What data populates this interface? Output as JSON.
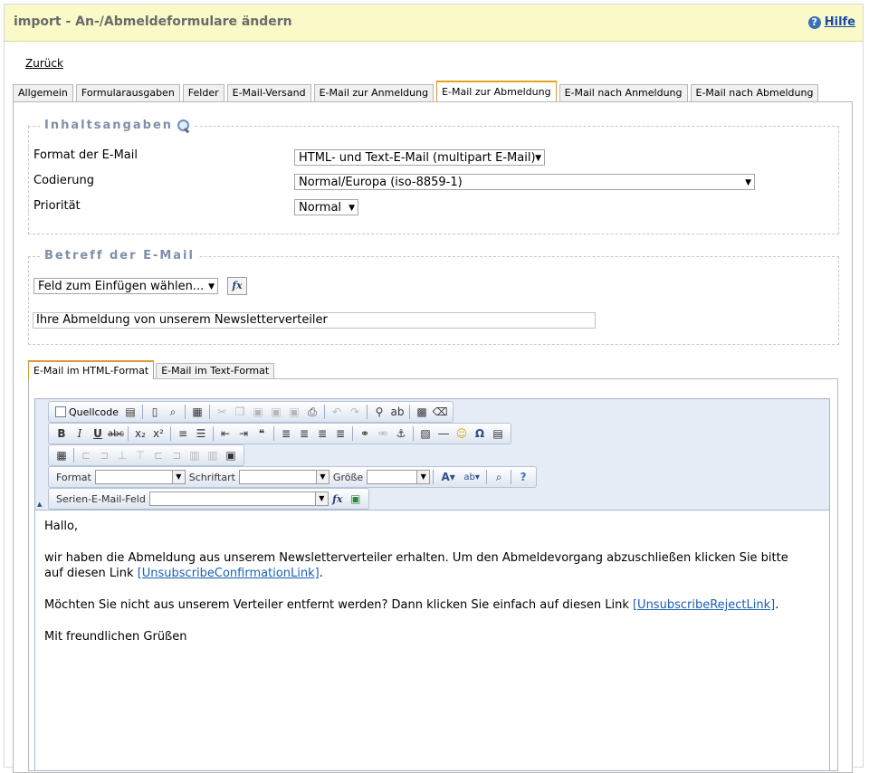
{
  "header": {
    "title": "import - An-/Abmeldeformulare ändern",
    "help_label": "Hilfe",
    "help_icon": "question-icon"
  },
  "back_link": "Zurück",
  "tabs": [
    {
      "label": "Allgemein",
      "active": false
    },
    {
      "label": "Formularausgaben",
      "active": false
    },
    {
      "label": "Felder",
      "active": false
    },
    {
      "label": "E-Mail-Versand",
      "active": false
    },
    {
      "label": "E-Mail zur Anmeldung",
      "active": false
    },
    {
      "label": "E-Mail zur Abmeldung",
      "active": true
    },
    {
      "label": "E-Mail nach Anmeldung",
      "active": false
    },
    {
      "label": "E-Mail nach Abmeldung",
      "active": false
    }
  ],
  "content_section": {
    "legend": "Inhaltsangaben",
    "format_label": "Format der E-Mail",
    "format_value": "HTML- und Text-E-Mail (multipart E-Mail)",
    "encoding_label": "Codierung",
    "encoding_value": "Normal/Europa (iso-8859-1)",
    "priority_label": "Priorität",
    "priority_value": "Normal"
  },
  "subject_section": {
    "legend": "Betreff der E-Mail",
    "field_select": "Feld zum Einfügen wählen...",
    "fx_label": "fx",
    "subject_value": "Ihre Abmeldung von unserem Newsletterverteiler"
  },
  "subtabs": [
    {
      "label": "E-Mail im HTML-Format",
      "active": true
    },
    {
      "label": "E-Mail im Text-Format",
      "active": false
    }
  ],
  "toolbar": {
    "source_label": "Quellcode",
    "format_label": "Format",
    "font_label": "Schriftart",
    "size_label": "Größe",
    "mailmerge_label": "Serien-E-Mail-Feld",
    "bold": "B",
    "italic": "I",
    "underline": "U",
    "strike": "abc",
    "fx": "fx",
    "omega": "Ω"
  },
  "body": {
    "greeting": "Hallo,",
    "p1_text": "wir haben die Abmeldung aus unserem Newsletterverteiler erhalten. Um den Abmeldevorgang abzuschließen klicken Sie bitte auf diesen Link ",
    "p1_link": "[UnsubscribeConfirmationLink]",
    "p1_end": ".",
    "p2_text": "Möchten Sie nicht aus unserem Verteiler entfernt werden? Dann klicken Sie einfach auf diesen Link ",
    "p2_link": "[UnsubscribeRejectLink]",
    "p2_end": ".",
    "closing": "Mit freundlichen Grüßen"
  },
  "colors": {
    "header_bg": "#fafac9",
    "active_tab_accent": "#e6a11f",
    "legend_text": "#7f8fa9",
    "link": "#1a5fb4"
  }
}
